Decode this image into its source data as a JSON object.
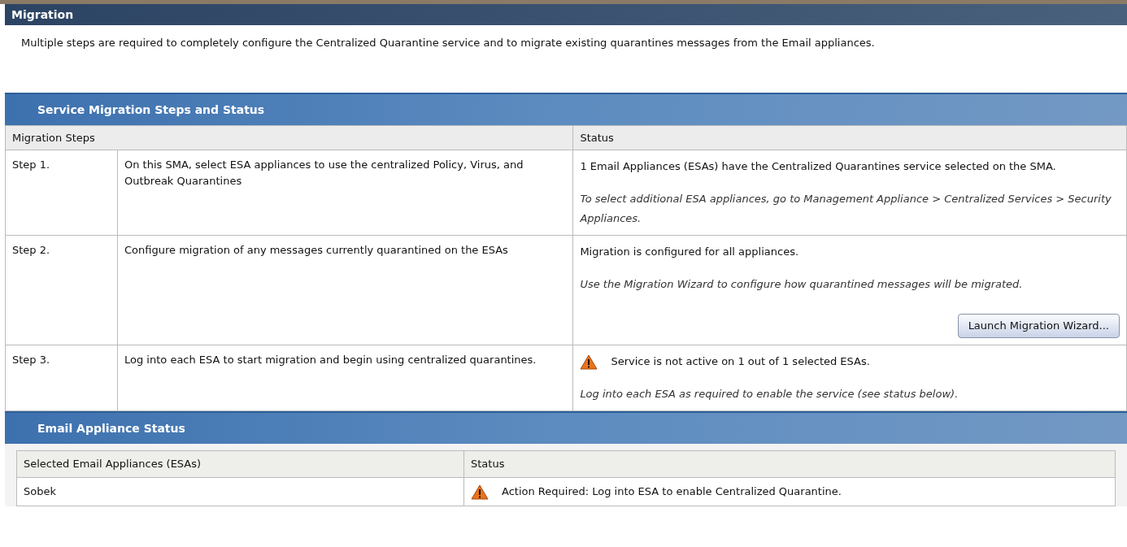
{
  "page_title": "Migration",
  "intro": "Multiple steps are required to completely configure the Centralized Quarantine service and to migrate existing quarantines messages from the Email appliances.",
  "migration_section": {
    "title": "Service Migration Steps and Status",
    "columns": [
      "Migration Steps",
      "Status"
    ],
    "steps": [
      {
        "step": "Step 1.",
        "description": "On this SMA, select ESA appliances to use the centralized Policy, Virus, and Outbreak Quarantines",
        "status": [
          {
            "kind": "text",
            "text": "1 Email Appliances (ESAs) have the Centralized Quarantines service selected on the SMA."
          },
          {
            "kind": "note",
            "text": "To select additional ESA appliances, go to Management Appliance > Centralized Services > Security Appliances."
          }
        ]
      },
      {
        "step": "Step 2.",
        "description": "Configure migration of any messages currently quarantined on the ESAs",
        "status": [
          {
            "kind": "text",
            "text": "Migration is configured for all appliances."
          },
          {
            "kind": "note",
            "text": "Use the Migration Wizard to configure how quarantined messages will be migrated."
          },
          {
            "kind": "button",
            "text": "Launch Migration Wizard..."
          }
        ]
      },
      {
        "step": "Step 3.",
        "description": "Log into each ESA to start migration and begin using centralized quarantines.",
        "status": [
          {
            "kind": "warning",
            "text": "Service is not active on 1 out of 1 selected ESAs."
          },
          {
            "kind": "note",
            "text": "Log into each ESA as required to enable the service (see status below)."
          }
        ]
      }
    ]
  },
  "appliance_section": {
    "title": "Email Appliance Status",
    "columns": [
      "Selected Email Appliances (ESAs)",
      "Status"
    ],
    "rows": [
      {
        "name": "Sobek",
        "status": "Action Required: Log into ESA to enable Centralized Quarantine."
      }
    ]
  }
}
